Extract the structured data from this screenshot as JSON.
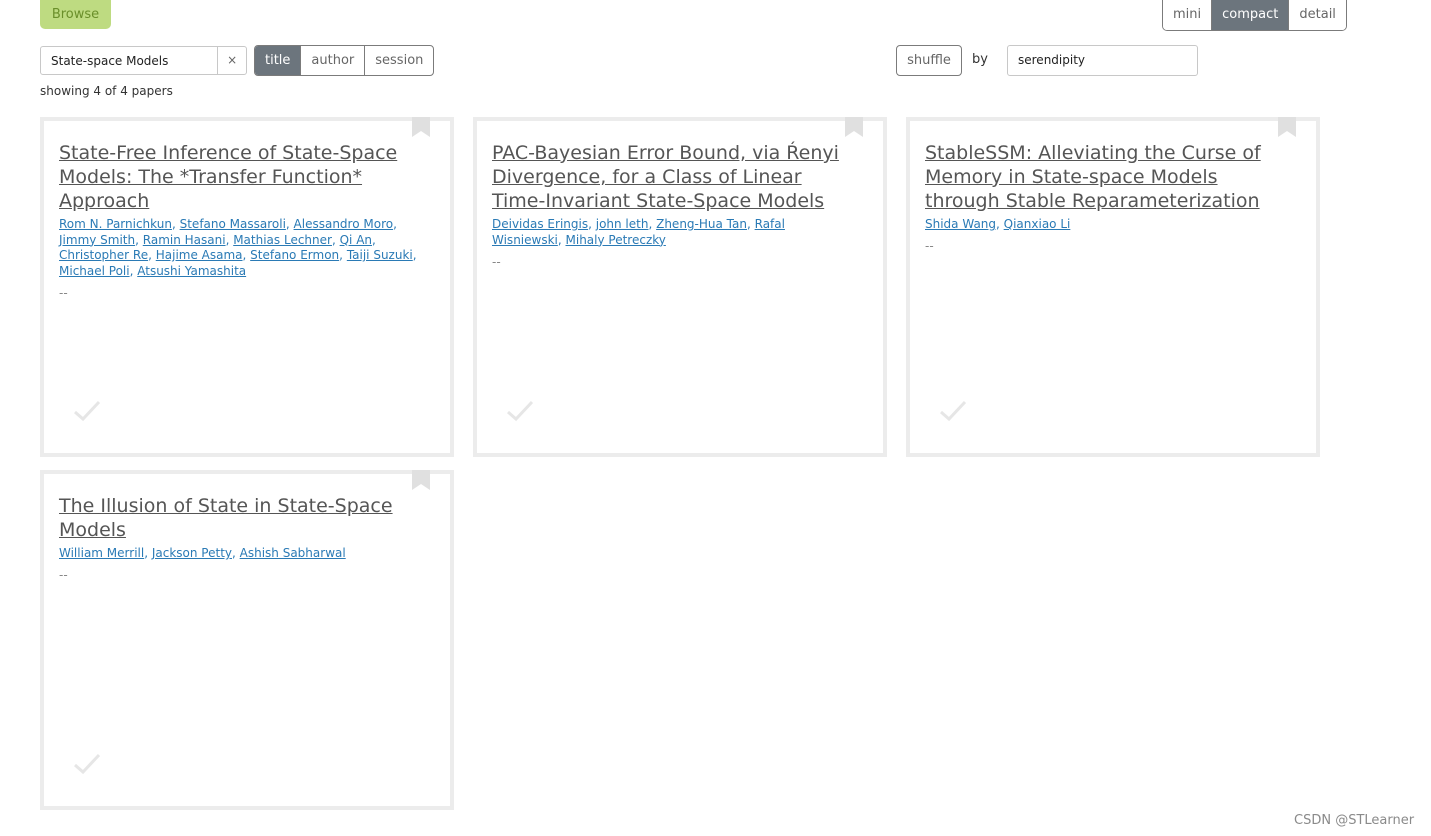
{
  "header": {
    "browse_label": "Browse",
    "views": [
      {
        "label": "mini",
        "active": false
      },
      {
        "label": "compact",
        "active": true
      },
      {
        "label": "detail",
        "active": false
      }
    ]
  },
  "search": {
    "value": "State-space Models",
    "clear_label": "×",
    "fields": [
      {
        "label": "title",
        "active": true
      },
      {
        "label": "author",
        "active": false
      },
      {
        "label": "session",
        "active": false
      }
    ],
    "showing_text": "showing 4 of 4 papers"
  },
  "sort": {
    "shuffle_label": "shuffle",
    "by_label": "by",
    "sort_value": "serendipity"
  },
  "papers": [
    {
      "title": "State-Free Inference of State-Space Models: The *Transfer Function* Approach",
      "authors": [
        "Rom N. Parnichkun",
        "Stefano Massaroli",
        "Alessandro Moro",
        "Jimmy Smith",
        "Ramin Hasani",
        "Mathias Lechner",
        "Qi An",
        "Christopher Re",
        "Hajime Asama",
        "Stefano Ermon",
        "Taiji Suzuki",
        "Michael Poli",
        "Atsushi Yamashita"
      ],
      "note": "--"
    },
    {
      "title": "PAC-Bayesian Error Bound, via Ŕenyi Divergence, for a Class of Linear Time-Invariant State-Space Models",
      "authors": [
        "Deividas Eringis",
        "john leth",
        "Zheng-Hua Tan",
        "Rafal Wisniewski",
        "Mihaly Petreczky"
      ],
      "note": "--"
    },
    {
      "title": "StableSSM: Alleviating the Curse of Memory in State-space Models through Stable Reparameterization",
      "authors": [
        "Shida Wang",
        "Qianxiao Li"
      ],
      "note": "--"
    },
    {
      "title": "The Illusion of State in State-Space Models",
      "authors": [
        "William Merrill",
        "Jackson Petty",
        "Ashish Sabharwal"
      ],
      "note": "--"
    }
  ],
  "footer": {
    "watermark": "CSDN @STLearner"
  },
  "colors": {
    "accent": "#bedb81",
    "active": "#6c757d",
    "link": "#2a7ab5"
  }
}
